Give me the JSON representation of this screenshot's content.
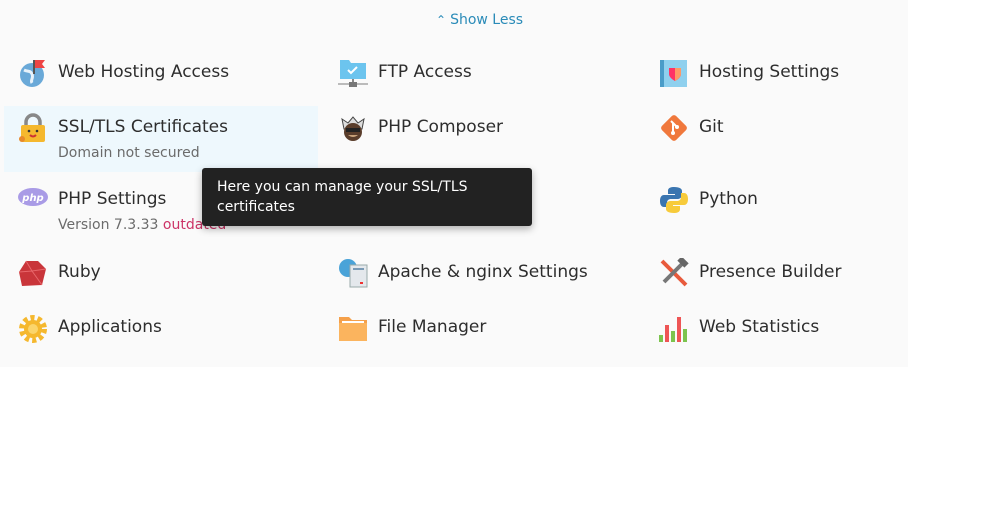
{
  "show_less": {
    "label": "Show Less",
    "icon": "chevron-up-icon"
  },
  "items": [
    {
      "label": "Web Hosting Access",
      "icon": "globe-flag-icon"
    },
    {
      "label": "FTP Access",
      "icon": "ftp-folder-icon"
    },
    {
      "label": "Hosting Settings",
      "icon": "hosting-settings-icon"
    },
    {
      "label": "SSL/TLS Certificates",
      "sub": "Domain not secured",
      "icon": "lock-icon"
    },
    {
      "label": "PHP Composer",
      "icon": "composer-icon"
    },
    {
      "label": "Git",
      "icon": "git-icon"
    },
    {
      "label": "PHP Settings",
      "sub": "Version 7.3.33",
      "sub_status": "outdated",
      "icon": "php-icon"
    },
    {
      "label": "Python",
      "icon": "python-icon"
    },
    {
      "label": "Ruby",
      "icon": "ruby-icon"
    },
    {
      "label": "Apache & nginx Settings",
      "icon": "apache-nginx-icon"
    },
    {
      "label": "Presence Builder",
      "icon": "tools-icon"
    },
    {
      "label": "Applications",
      "icon": "gear-icon"
    },
    {
      "label": "File Manager",
      "icon": "folder-icon"
    },
    {
      "label": "Web Statistics",
      "icon": "bar-chart-icon"
    }
  ],
  "tooltip": {
    "text": "Here you can manage your SSL/TLS certificates"
  },
  "colors": {
    "link": "#2a8bb8",
    "warning": "#cc3366",
    "tooltip_bg": "#222222",
    "highlight": "#eef8fd"
  }
}
